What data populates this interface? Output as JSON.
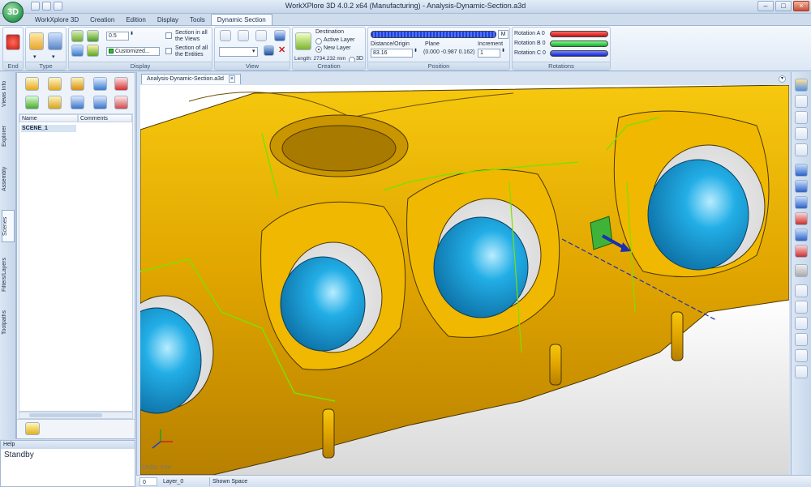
{
  "app": {
    "title": "WorkXPlore 3D 4.0.2 x64 (Manufacturing) - Analysis-Dynamic-Section.a3d",
    "logo_text": "3D"
  },
  "tabs": [
    "WorkXplore 3D",
    "Creation",
    "Edition",
    "Display",
    "Tools",
    "Dynamic Section"
  ],
  "active_tab": "Dynamic Section",
  "ribbon": {
    "end": {
      "label": "End"
    },
    "type": {
      "label": "Type"
    },
    "display": {
      "label": "Display",
      "value": "0.5",
      "color_option": "Customized...",
      "section_all_views": "Section in all the Views",
      "section_all_entities": "Section of all the Entities"
    },
    "view": {
      "label": "View"
    },
    "creation": {
      "label": "Creation",
      "destination": "Destination",
      "active_layer": "Active Layer",
      "new_layer": "New Layer",
      "length": "Length: 2734.232 mm",
      "three_d": "3D"
    },
    "position": {
      "label": "Position",
      "distance_label": "Distance/Origin",
      "distance_value": "83.16",
      "plane_label": "Plane",
      "plane_value": "(0.000 -0.987 0.162)",
      "increment_label": "Increment",
      "increment_value": "1",
      "m_button": "M"
    },
    "rotations": {
      "label": "Rotations",
      "a": "Rotation A 0",
      "b": "Rotation B 0",
      "c": "Rotation C 0",
      "colors": [
        "#dd1f1f",
        "#1fc43a",
        "#1f2fd8"
      ]
    }
  },
  "left_tabs": [
    "Views Info",
    "Explorer",
    "Assembly",
    "Scenes",
    "Filters/Layers",
    "Toolpaths"
  ],
  "panel": {
    "columns": [
      "Name",
      "Comments"
    ],
    "rows": [
      {
        "name": "SCENE_1",
        "comment": ""
      }
    ]
  },
  "help": {
    "title": "Help",
    "text": "Standby"
  },
  "document": {
    "tab": "Analysis-Dynamic-Section.a3d",
    "units": "Units: mm"
  },
  "status": {
    "layer_num": "0",
    "layer_name": "Layer_0",
    "space": "Shown Space"
  },
  "colors": {
    "part": "#d9a500",
    "part_dark": "#8a6500",
    "sphere": "#1a9fd6",
    "section_edge": "#7ee000"
  }
}
